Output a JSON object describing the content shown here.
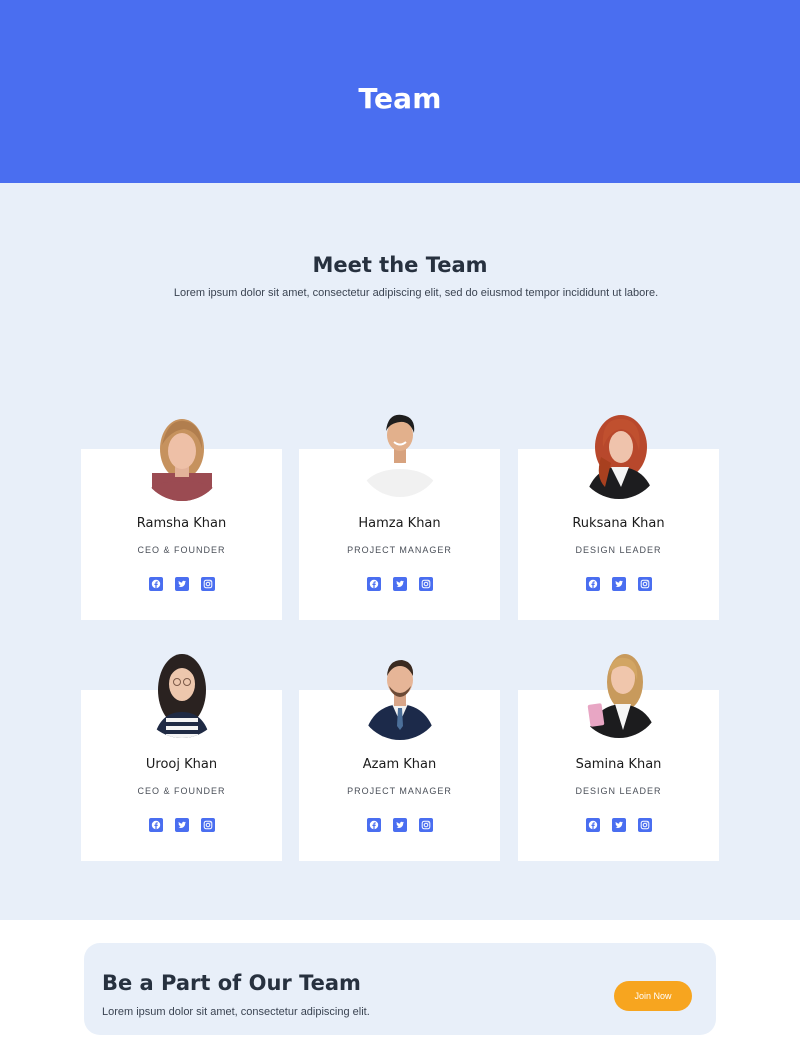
{
  "hero": {
    "title": "Team"
  },
  "team": {
    "heading": "Meet the Team",
    "subtitle": "Lorem ipsum dolor sit amet, consectetur adipiscing elit, sed do eiusmod tempor incididunt ut labore.",
    "members": [
      {
        "name": "Ramsha Khan",
        "role": "CEO & FOUNDER"
      },
      {
        "name": "Hamza Khan",
        "role": "PROJECT MANAGER"
      },
      {
        "name": "Ruksana Khan",
        "role": "DESIGN LEADER"
      },
      {
        "name": "Urooj Khan",
        "role": "CEO & FOUNDER"
      },
      {
        "name": "Azam Khan",
        "role": "PROJECT MANAGER"
      },
      {
        "name": "Samina Khan",
        "role": "DESIGN LEADER"
      }
    ],
    "social_icons": [
      "facebook-icon",
      "twitter-icon",
      "instagram-icon"
    ]
  },
  "cta": {
    "title": "Be a Part of Our Team",
    "text": "Lorem ipsum dolor sit amet, consectetur adipiscing elit.",
    "button_label": "Join Now"
  },
  "colors": {
    "primary": "#4a6ef0",
    "section_bg": "#e8eff9",
    "accent": "#f7a51f",
    "heading": "#27313f"
  }
}
